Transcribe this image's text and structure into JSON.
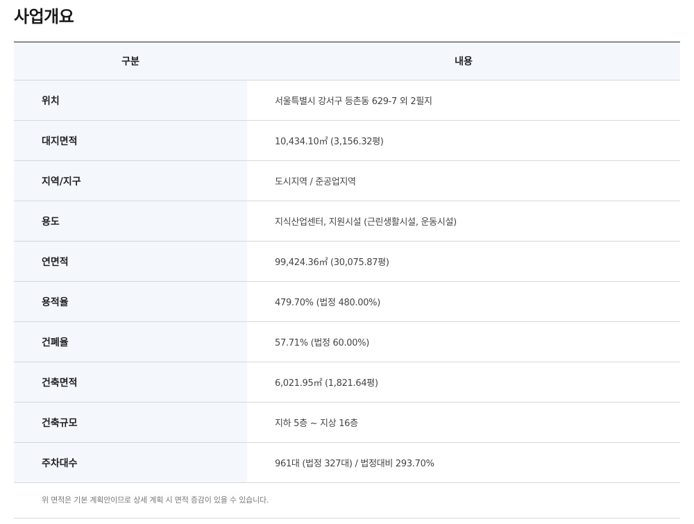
{
  "page": {
    "title": "사업개요"
  },
  "table": {
    "headers": {
      "label": "구분",
      "value": "내용"
    },
    "rows": [
      {
        "label": "위치",
        "value": "서울특별시 강서구 등촌동 629-7 외 2필지"
      },
      {
        "label": "대지면적",
        "value": "10,434.10㎡ (3,156.32평)"
      },
      {
        "label": "지역/지구",
        "value": "도시지역 / 준공업지역"
      },
      {
        "label": "용도",
        "value": "지식산업센터, 지원시설 (근린생활시설, 운동시설)"
      },
      {
        "label": "연면적",
        "value": "99,424.36㎡ (30,075.87평)"
      },
      {
        "label": "용적율",
        "value": "479.70% (법정 480.00%)"
      },
      {
        "label": "건폐율",
        "value": "57.71% (법정 60.00%)"
      },
      {
        "label": "건축면적",
        "value": "6,021.95㎡ (1,821.64평)"
      },
      {
        "label": "건축규모",
        "value": "지하 5층 ~ 지상 16층"
      },
      {
        "label": "주차대수",
        "value": "961대 (법정 327대) / 법정대비 293.70%"
      }
    ]
  },
  "footnote": {
    "text": "위 면적은 기본 계획안이므로 상세 계획 시 면적 증감이 있을 수 있습니다."
  }
}
